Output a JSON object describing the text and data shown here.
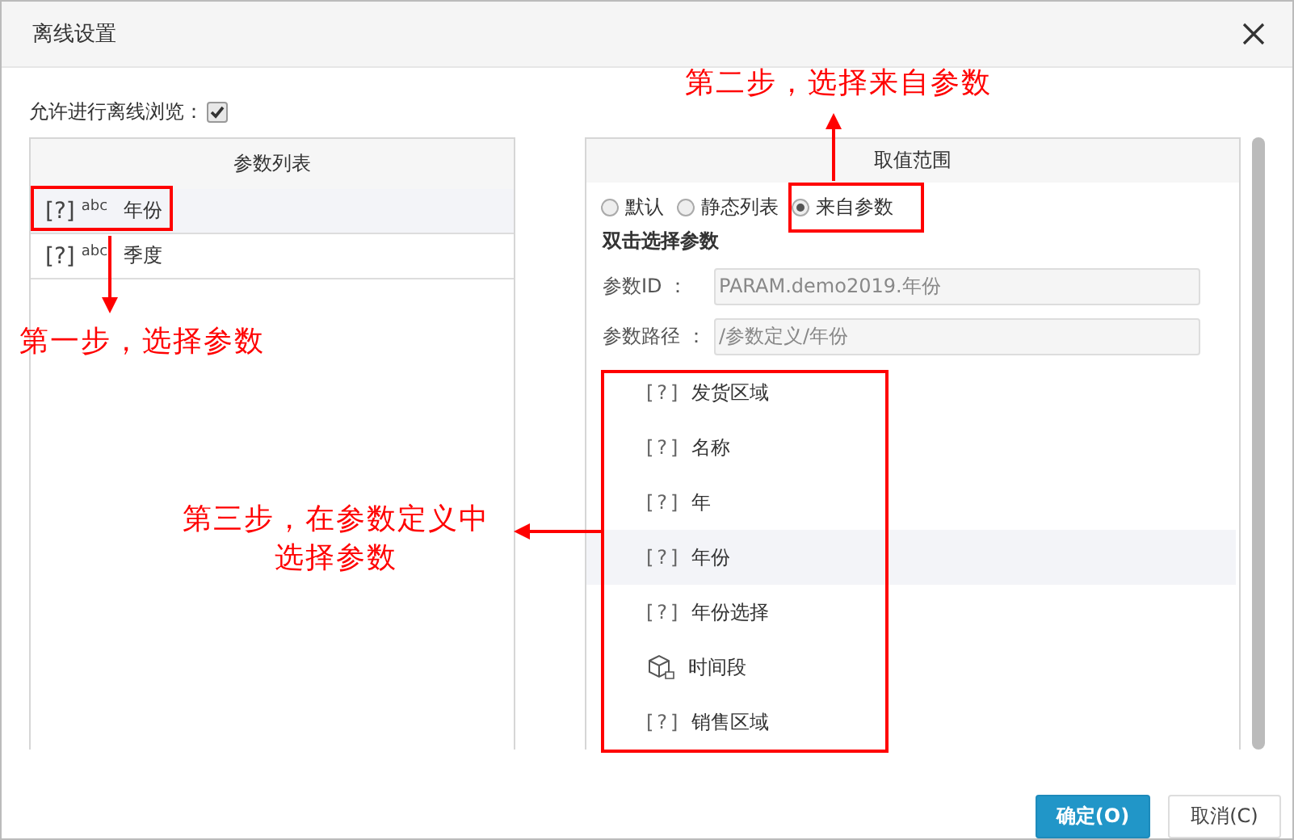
{
  "window": {
    "title": "离线设置"
  },
  "allow_offline": {
    "label": "允许进行离线浏览：",
    "checked": true
  },
  "param_list": {
    "header": "参数列表",
    "items": [
      {
        "icon_text": "[?]",
        "type_label": "abc",
        "name": "年份",
        "selected": true
      },
      {
        "icon_text": "[?]",
        "type_label": "abc",
        "name": "季度",
        "selected": false
      }
    ]
  },
  "value_range": {
    "header": "取值范围",
    "options": [
      {
        "label": "默认",
        "selected": false
      },
      {
        "label": "静态列表",
        "selected": false
      },
      {
        "label": "来自参数",
        "selected": true
      }
    ],
    "hint": "双击选择参数",
    "fields": [
      {
        "label": "参数ID ：",
        "value": "PARAM.demo2019.年份"
      },
      {
        "label": "参数路径 ：",
        "value": "/参数定义/年份"
      }
    ],
    "params": [
      {
        "kind": "param",
        "icon_text": "[?]",
        "name": "发货区域",
        "selected": false
      },
      {
        "kind": "param",
        "icon_text": "[?]",
        "name": "名称",
        "selected": false
      },
      {
        "kind": "param",
        "icon_text": "[?]",
        "name": "年",
        "selected": false
      },
      {
        "kind": "param",
        "icon_text": "[?]",
        "name": "年份",
        "selected": true
      },
      {
        "kind": "param",
        "icon_text": "[?]",
        "name": "年份选择",
        "selected": false
      },
      {
        "kind": "cube",
        "name": "时间段",
        "selected": false
      },
      {
        "kind": "param",
        "icon_text": "[?]",
        "name": "销售区域",
        "selected": false
      }
    ]
  },
  "buttons": [
    {
      "kind": "primary",
      "label": "确定(O)"
    },
    {
      "kind": "secondary",
      "label": "取消(C)"
    }
  ],
  "annotations": [
    {
      "text": "第一步，选择参数"
    },
    {
      "text": "第二步，选择来自参数"
    },
    {
      "text": "第三步，在参数定义中选择参数"
    }
  ]
}
